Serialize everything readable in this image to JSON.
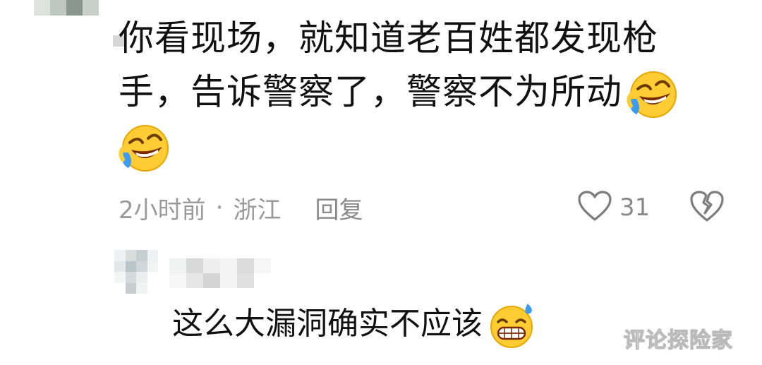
{
  "comment": {
    "text_lines": [
      "你看现场，就知道老百姓都发现枪",
      "手，告诉警察了，警察不为所动",
      ""
    ],
    "emojis": [
      "rofl-crying-laughing-emoji",
      "rofl-crying-laughing-emoji"
    ],
    "time": "2小时前",
    "separator": "·",
    "location": "浙江",
    "reply_label": "回复",
    "like_count": "31"
  },
  "reply": {
    "text": "这么大漏洞确实不应该",
    "emoji": "grinning-sweat-emoji"
  },
  "watermark": "评论探险家",
  "colors": {
    "text": "#111111",
    "meta": "#9a9a9a",
    "emoji_face": "#ffcc33",
    "emoji_tear": "#3b9cf2"
  }
}
